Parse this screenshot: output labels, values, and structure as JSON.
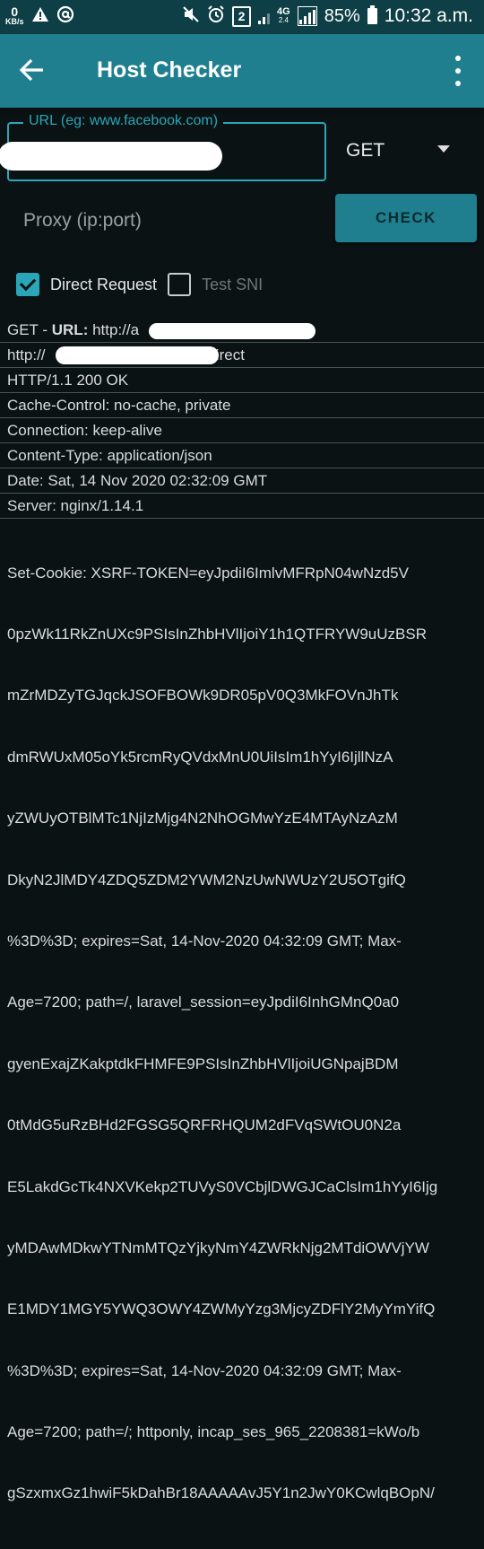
{
  "status_bar": {
    "kbs_value": "0",
    "kbs_unit": "KB/s",
    "network_type": "4G",
    "network_sub": "2.4",
    "sim_badge": "2",
    "battery": "85%",
    "time": "10:32 a.m."
  },
  "app_bar": {
    "title": "Host Checker"
  },
  "url_field": {
    "label": "URL (eg: www.facebook.com)"
  },
  "method": {
    "selected": "GET"
  },
  "proxy": {
    "placeholder": "Proxy (ip:port)"
  },
  "check_button": {
    "label": "CHECK"
  },
  "options": {
    "direct_request": {
      "label": "Direct Request",
      "checked": true
    },
    "test_sni": {
      "label": "Test SNI",
      "checked": false
    }
  },
  "output": {
    "request_method": "GET - ",
    "url_key": "URL:",
    "url_value": " http://a",
    "direct_prefix": "http://",
    "direct_suffix": "Direct",
    "lines": [
      "HTTP/1.1 200 OK",
      "Cache-Control: no-cache, private",
      "Connection: keep-alive",
      "Content-Type: application/json",
      "Date: Sat, 14 Nov 2020 02:32:09 GMT",
      "Server: nginx/1.14.1"
    ],
    "set_cookie_lines": [
      "Set-Cookie: XSRF-TOKEN=eyJpdiI6ImlvMFRpN04wNzd5V",
      "0pzWk11RkZnUXc9PSIsInZhbHVlIjoiY1h1QTFRYW9uUzBSR",
      "mZrMDZyTGJqckJSOFBOWk9DR05pV0Q3MkFOVnJhTk",
      "dmRWUxM05oYk5rcmRyQVdxMnU0UiIsIm1hYyI6IjllNzA",
      "yZWUyOTBlMTc1NjIzMjg4N2NhOGMwYzE4MTAyNzAzM",
      "DkyN2JlMDY4ZDQ5ZDM2YWM2NzUwNWUzY2U5OTgifQ",
      "%3D%3D; expires=Sat, 14-Nov-2020 04:32:09 GMT; Max-",
      "Age=7200; path=/, laravel_session=eyJpdiI6InhGMnQ0a0",
      "gyenExajZKakptdkFHMFE9PSIsInZhbHVlIjoiUGNpajBDM",
      "0tMdG5uRzBHd2FGSG5QRFRHQUM2dFVqSWtOU0N2a",
      "E5LakdGcTk4NXVKekp2TUVyS0VCbjlDWGJCaClsIm1hYyI6Ijg",
      "yMDAwMDkwYTNmMTQzYjkyNmY4ZWRkNjg2MTdiOWVjYW",
      "E1MDY1MGY5YWQ3OWY4ZWMyYzg3MjcyZDFlY2MyYmYifQ",
      "%3D%3D; expires=Sat, 14-Nov-2020 04:32:09 GMT; Max-",
      "Age=7200; path=/; httponly, incap_ses_965_2208381=kWo/b",
      "gSzxmxGz1hwiF5kDahBr18AAAAAvJ5Y1n2JwY0KCwlqBOpN/"
    ]
  }
}
